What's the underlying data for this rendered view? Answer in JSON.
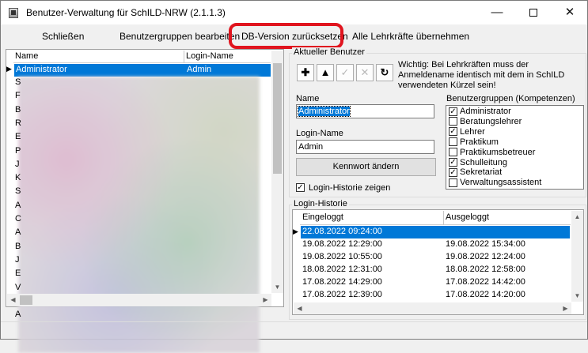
{
  "window": {
    "title": "Benutzer-Verwaltung für SchILD-NRW (2.1.1.3)",
    "minimize": "—",
    "close": "✕"
  },
  "menu": {
    "close": "Schließen",
    "edit_groups": "Benutzergruppen bearbeiten",
    "reset_db": "DB-Version zurücksetzen",
    "import_teachers": "Alle Lehrkräfte übernehmen"
  },
  "highlight_color": "#e0141e",
  "user_list": {
    "columns": [
      "Name",
      "Login-Name"
    ],
    "selected": {
      "name": "Administrator",
      "login": "Admin"
    },
    "row_initials": [
      "S",
      "F",
      "B",
      "R",
      "E",
      "P",
      "J",
      "K",
      "S",
      "A",
      "C",
      "A",
      "B",
      "J",
      "E",
      "V",
      "C",
      "A"
    ]
  },
  "current_user": {
    "group_title": "Aktueller Benutzer",
    "toolbar": {
      "add": "✚",
      "up": "▲",
      "confirm": "✓",
      "cancel": "✕",
      "refresh": "↻"
    },
    "notice": "Wichtig: Bei Lehrkräften muss der Anmeldename identisch mit dem in SchILD verwendeten Kürzel sein!",
    "name_label": "Name",
    "name_value": "Administrator",
    "login_label": "Login-Name",
    "login_value": "Admin",
    "change_password": "Kennwort ändern",
    "show_history": "Login-Historie zeigen",
    "show_history_checked": "✓",
    "groups_label": "Benutzergruppen (Kompetenzen)",
    "groups": [
      {
        "label": "Administrator",
        "check": "✓"
      },
      {
        "label": "Beratungslehrer",
        "check": ""
      },
      {
        "label": "Lehrer",
        "check": "✓"
      },
      {
        "label": "Praktikum",
        "check": ""
      },
      {
        "label": "Praktikumsbetreuer",
        "check": ""
      },
      {
        "label": "Schulleitung",
        "check": "✓"
      },
      {
        "label": "Sekretariat",
        "check": "✓"
      },
      {
        "label": "Verwaltungsassistent",
        "check": ""
      }
    ]
  },
  "history": {
    "group_title": "Login-Historie",
    "columns": [
      "Eingeloggt",
      "Ausgeloggt"
    ],
    "rows": [
      {
        "in": "22.08.2022 09:24:00",
        "out": ""
      },
      {
        "in": "19.08.2022 12:29:00",
        "out": "19.08.2022 15:34:00"
      },
      {
        "in": "19.08.2022 10:55:00",
        "out": "19.08.2022 12:24:00"
      },
      {
        "in": "18.08.2022 12:31:00",
        "out": "18.08.2022 12:58:00"
      },
      {
        "in": "17.08.2022 14:29:00",
        "out": "17.08.2022 14:42:00"
      },
      {
        "in": "17.08.2022 12:39:00",
        "out": "17.08.2022 14:20:00"
      }
    ]
  }
}
